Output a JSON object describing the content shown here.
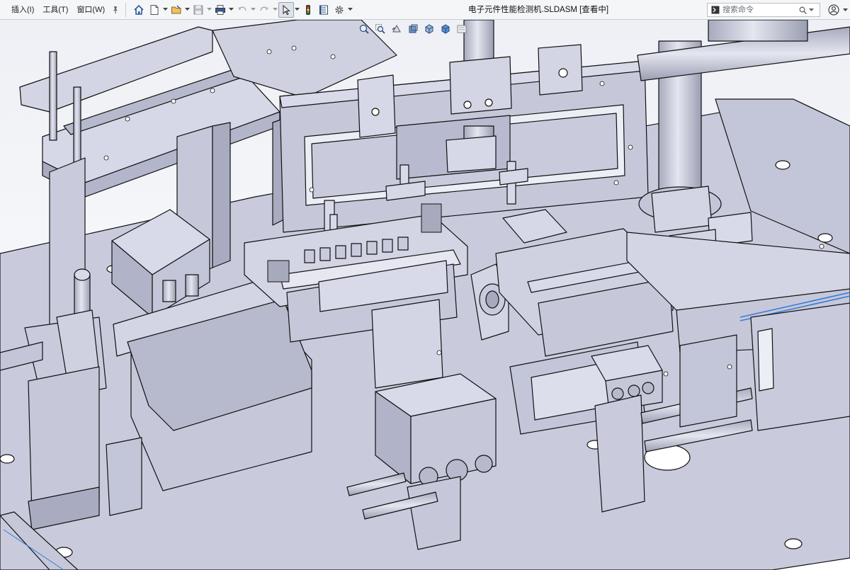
{
  "menu": {
    "insert": "插入(I)",
    "tools": "工具(T)",
    "window": "窗口(W)"
  },
  "document": {
    "title": "电子元件性能检测机.SLDASM [查看中]"
  },
  "search": {
    "placeholder": "搜索命令"
  },
  "icons": {
    "pin": "pin-icon",
    "home": "home-icon",
    "new": "new-document-icon",
    "open": "open-folder-icon",
    "save": "save-icon",
    "print": "print-icon",
    "undo": "undo-icon",
    "redo": "redo-icon",
    "select": "select-arrow-icon",
    "traffic": "rebuild-light-icon",
    "file_props": "file-properties-icon",
    "options": "gear-icon",
    "command": "command-prompt-icon",
    "search": "search-icon",
    "user": "user-icon"
  },
  "colors": {
    "viewport_bg_top": "#f2f4f8",
    "viewport_bg_bottom": "#ffffff",
    "model_fill": "#c8cbdc",
    "model_face_light": "#d8daea",
    "model_face_dark": "#a9acc0",
    "edge": "#111111",
    "accent_blue": "#3a7bd5"
  }
}
